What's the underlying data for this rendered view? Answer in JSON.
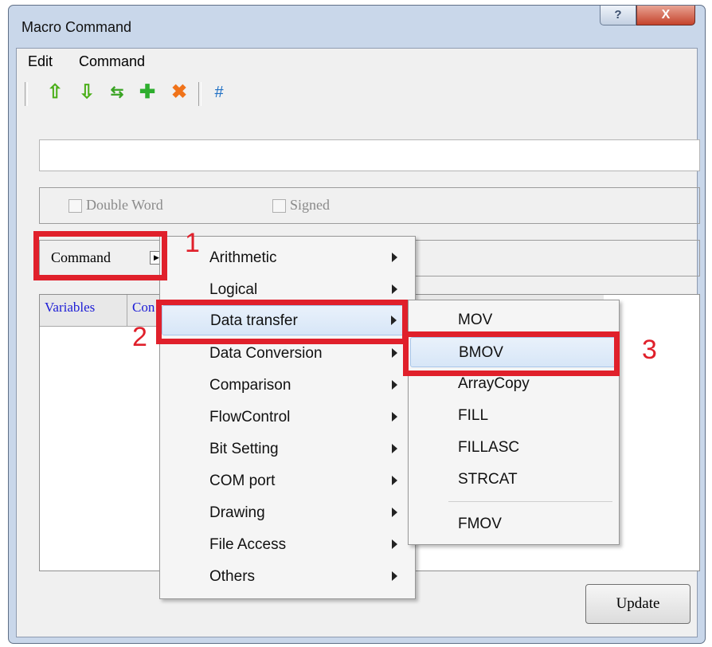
{
  "window": {
    "title": "Macro Command",
    "help_glyph": "?",
    "close_glyph": "X"
  },
  "menubar": {
    "items": [
      {
        "label": "Edit"
      },
      {
        "label": "Command"
      }
    ]
  },
  "toolbar": {
    "icons": [
      {
        "name": "move-up-arrow-icon",
        "glyph": "⇧",
        "color": "#4caf1a"
      },
      {
        "name": "move-down-arrow-icon",
        "glyph": "⇩",
        "color": "#4caf1a"
      },
      {
        "name": "swap-arrows-icon",
        "glyph": "⇆",
        "color": "#3aa324"
      },
      {
        "name": "add-plus-icon",
        "glyph": "✚",
        "color": "#2eae2e"
      },
      {
        "name": "delete-x-icon",
        "glyph": "✖",
        "color": "#f0731a"
      },
      {
        "name": "hash-icon",
        "glyph": "#",
        "color": "#1e6fc4"
      }
    ]
  },
  "options": {
    "double_word_label": "Double Word",
    "signed_label": "Signed"
  },
  "command_row": {
    "label": "Command"
  },
  "tabs": {
    "variables_label": "Variables",
    "second_label": "Con"
  },
  "buttons": {
    "update_label": "Update"
  },
  "command_menu": {
    "items": [
      {
        "label": "Arithmetic"
      },
      {
        "label": "Logical"
      },
      {
        "label": "Data transfer",
        "highlighted": true
      },
      {
        "label": "Data Conversion"
      },
      {
        "label": "Comparison"
      },
      {
        "label": "FlowControl"
      },
      {
        "label": "Bit Setting"
      },
      {
        "label": "COM port"
      },
      {
        "label": "Drawing"
      },
      {
        "label": "File Access"
      },
      {
        "label": "Others"
      }
    ]
  },
  "submenu": {
    "items": [
      {
        "label": "MOV"
      },
      {
        "label": "BMOV",
        "highlighted": true
      },
      {
        "label": "ArrayCopy"
      },
      {
        "label": "FILL"
      },
      {
        "label": "FILLASC"
      },
      {
        "label": "STRCAT"
      },
      {
        "label": "FMOV"
      }
    ]
  },
  "annotations": {
    "step1": "1",
    "step2": "2",
    "step3": "3",
    "color": "#e0202b"
  }
}
